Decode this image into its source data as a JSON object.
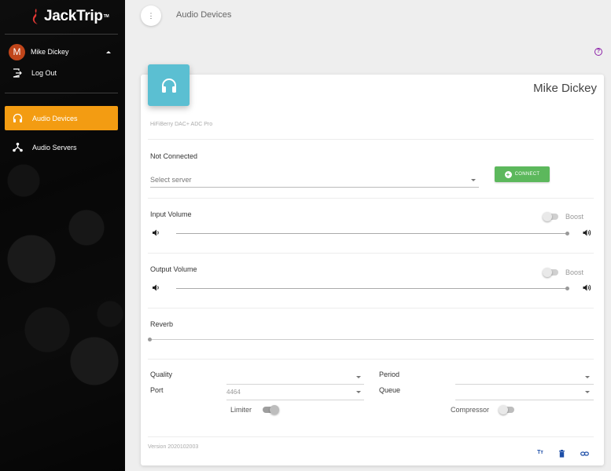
{
  "app": {
    "logo_text": "JackTrip",
    "logo_tm": "TM"
  },
  "sidebar": {
    "user": {
      "initial": "M",
      "name": "Mike Dickey"
    },
    "logout_label": "Log Out",
    "items": [
      {
        "label": "Audio Devices",
        "icon": "headphones-icon",
        "active": true
      },
      {
        "label": "Audio Servers",
        "icon": "network-icon",
        "active": false
      }
    ]
  },
  "header": {
    "title": "Audio Devices"
  },
  "device_card": {
    "title": "Mike Dickey",
    "device_name": "HiFiBerry DAC+ ADC Pro",
    "connection_status": "Not Connected",
    "server_placeholder": "Select server",
    "connect_label": "CONNECT",
    "input_volume_label": "Input Volume",
    "output_volume_label": "Output Volume",
    "boost_label": "Boost",
    "reverb_label": "Reverb",
    "input_volume_level": 0.99,
    "output_volume_level": 0.99,
    "reverb_level": 0.0,
    "quality_label": "Quality",
    "quality_value": "",
    "port_label": "Port",
    "port_value": "4464",
    "period_label": "Period",
    "period_value": "",
    "queue_label": "Queue",
    "queue_value": "",
    "limiter_label": "Limiter",
    "limiter_on": true,
    "compressor_label": "Compressor",
    "compressor_on": false,
    "version": "Version 2020102003"
  },
  "colors": {
    "accent": "#f39c12",
    "device_icon_bg": "#5bbfd2",
    "connect_green": "#5cb85c",
    "avatar": "#c0451a",
    "footer_icons": "#1e4fa8"
  }
}
